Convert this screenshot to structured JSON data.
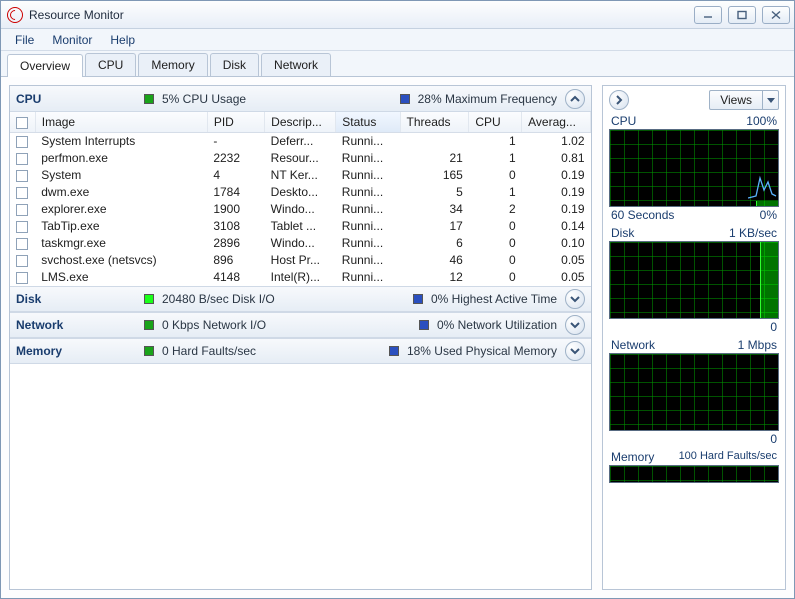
{
  "window": {
    "title": "Resource Monitor"
  },
  "menu": {
    "file": "File",
    "monitor": "Monitor",
    "help": "Help"
  },
  "tabs": {
    "overview": "Overview",
    "cpu": "CPU",
    "memory": "Memory",
    "disk": "Disk",
    "network": "Network"
  },
  "cpu_section": {
    "title": "CPU",
    "swatches": {
      "usage": "#1aa31a",
      "freq": "#2a4fbf"
    },
    "usage_label": "5% CPU Usage",
    "freq_label": "28% Maximum Frequency",
    "columns": {
      "image": "Image",
      "pid": "PID",
      "desc": "Descrip...",
      "status": "Status",
      "threads": "Threads",
      "cpu": "CPU",
      "avg": "Averag..."
    },
    "rows": [
      {
        "image": "System Interrupts",
        "pid": "-",
        "desc": "Deferr...",
        "status": "Runni...",
        "threads": "",
        "cpu": "1",
        "avg": "1.02"
      },
      {
        "image": "perfmon.exe",
        "pid": "2232",
        "desc": "Resour...",
        "status": "Runni...",
        "threads": "21",
        "cpu": "1",
        "avg": "0.81"
      },
      {
        "image": "System",
        "pid": "4",
        "desc": "NT Ker...",
        "status": "Runni...",
        "threads": "165",
        "cpu": "0",
        "avg": "0.19"
      },
      {
        "image": "dwm.exe",
        "pid": "1784",
        "desc": "Deskto...",
        "status": "Runni...",
        "threads": "5",
        "cpu": "1",
        "avg": "0.19"
      },
      {
        "image": "explorer.exe",
        "pid": "1900",
        "desc": "Windo...",
        "status": "Runni...",
        "threads": "34",
        "cpu": "2",
        "avg": "0.19"
      },
      {
        "image": "TabTip.exe",
        "pid": "3108",
        "desc": "Tablet ...",
        "status": "Runni...",
        "threads": "17",
        "cpu": "0",
        "avg": "0.14"
      },
      {
        "image": "taskmgr.exe",
        "pid": "2896",
        "desc": "Windo...",
        "status": "Runni...",
        "threads": "6",
        "cpu": "0",
        "avg": "0.10"
      },
      {
        "image": "svchost.exe (netsvcs)",
        "pid": "896",
        "desc": "Host Pr...",
        "status": "Runni...",
        "threads": "46",
        "cpu": "0",
        "avg": "0.05"
      },
      {
        "image": "LMS.exe",
        "pid": "4148",
        "desc": "Intel(R)...",
        "status": "Runni...",
        "threads": "12",
        "cpu": "0",
        "avg": "0.05"
      }
    ]
  },
  "disk_section": {
    "title": "Disk",
    "swatches": {
      "io": "#1aff1a",
      "active": "#2a4fbf"
    },
    "io_label": "20480 B/sec Disk I/O",
    "active_label": "0% Highest Active Time"
  },
  "network_section": {
    "title": "Network",
    "swatches": {
      "io": "#1aa31a",
      "util": "#2a4fbf"
    },
    "io_label": "0 Kbps Network I/O",
    "util_label": "0% Network Utilization"
  },
  "memory_section": {
    "title": "Memory",
    "swatches": {
      "faults": "#1aa31a",
      "used": "#2a4fbf"
    },
    "faults_label": "0 Hard Faults/sec",
    "used_label": "18% Used Physical Memory"
  },
  "right": {
    "views_label": "Views",
    "cpu": {
      "title": "CPU",
      "right": "100%",
      "sub_left": "60 Seconds",
      "sub_right": "0%"
    },
    "disk": {
      "title": "Disk",
      "right": "1 KB/sec",
      "sub_right": "0"
    },
    "network": {
      "title": "Network",
      "right": "1 Mbps",
      "sub_right": "0"
    },
    "memory": {
      "title": "Memory",
      "right": "100 Hard Faults/sec"
    }
  }
}
